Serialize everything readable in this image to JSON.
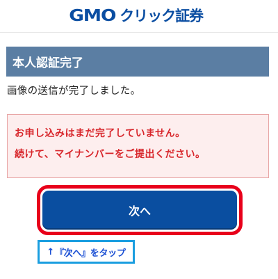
{
  "header": {
    "logo_gmo": "GMO",
    "logo_rest": "クリック証券"
  },
  "section": {
    "title": "本人認証完了"
  },
  "message": "画像の送信が完了しました。",
  "alert": {
    "line1": "お申し込みはまだ完了していません。",
    "line2": "続けて、マイナンバーをご提出ください。",
    "color": "#d8262b"
  },
  "next_button": {
    "label": "次へ",
    "color": "#0a4ea0",
    "highlight_color": "#e8001a"
  },
  "annotation": {
    "arrow": "↑",
    "text": "『次へ』をタップ",
    "color": "#1a4fd4"
  }
}
